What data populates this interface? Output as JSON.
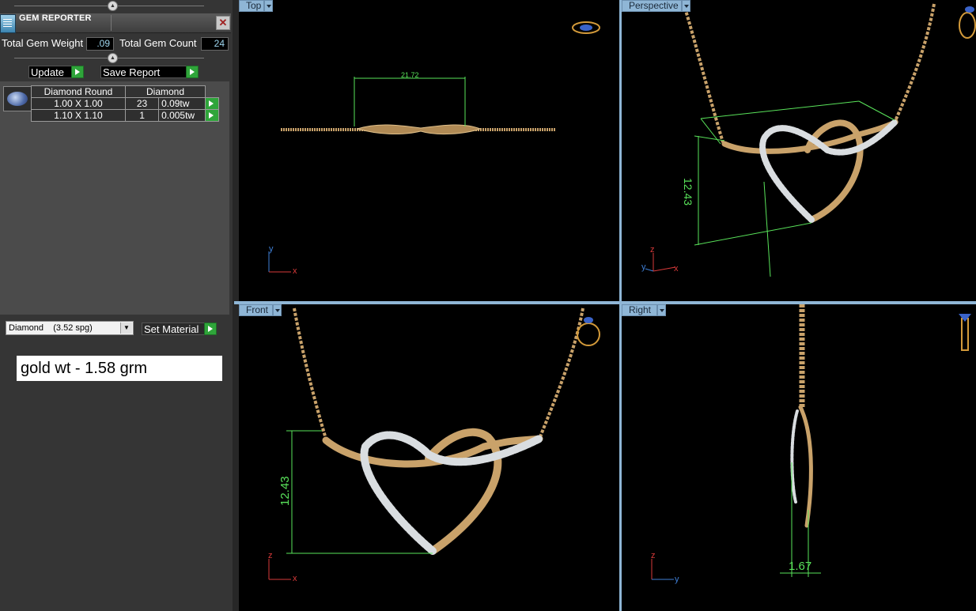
{
  "panel": {
    "title": "GEM REPORTER",
    "close_glyph": "✕",
    "total_weight_label": "Total Gem Weight",
    "total_weight_value": ".09",
    "total_count_label": "Total Gem Count",
    "total_count_value": "24",
    "update_label": "Update",
    "save_report_label": "Save Report",
    "gem_table": {
      "headers": [
        "Diamond Round",
        "Diamond"
      ],
      "rows": [
        {
          "size": "1.00 X 1.00",
          "count": "23",
          "weight": "0.09tw"
        },
        {
          "size": "1.10 X 1.10",
          "count": "1",
          "weight": "0.005tw"
        }
      ]
    },
    "material_value": "Diamond    (3.52 spg)",
    "set_material_label": "Set Material",
    "note": "gold wt - 1.58 grm"
  },
  "viewports": {
    "top": {
      "label": "Top",
      "dimension": "21.72",
      "axis_y": "y",
      "axis_x": "x"
    },
    "perspective": {
      "label": "Perspective",
      "dimension": "12.43",
      "axis_z": "z",
      "axis_y": "y",
      "axis_x": "x"
    },
    "front": {
      "label": "Front",
      "dimension": "12.43",
      "axis_z": "z",
      "axis_x": "x"
    },
    "right": {
      "label": "Right",
      "dimension": "1.67",
      "axis_z": "z",
      "axis_y": "y"
    }
  },
  "colors": {
    "gold": "#c9a26a",
    "silver": "#d9dde0",
    "dimension": "#59e35a",
    "viewport_tab": "#8fb6d6"
  }
}
